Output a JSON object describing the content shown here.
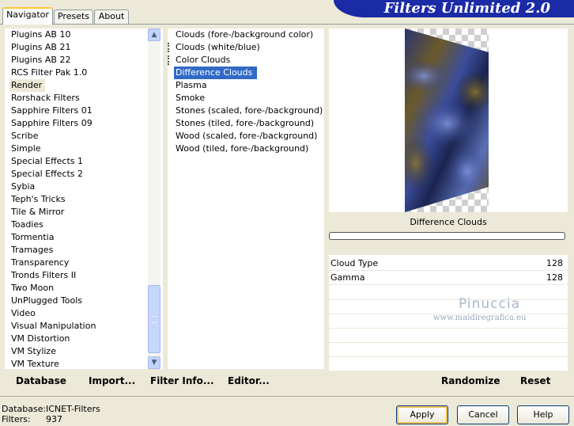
{
  "tabs": [
    {
      "label": "Navigator",
      "active": true
    },
    {
      "label": "Presets",
      "active": false
    },
    {
      "label": "About",
      "active": false
    }
  ],
  "brand": "Filters Unlimited 2.0",
  "categories": [
    "Plugins AB 10",
    "Plugins AB 21",
    "Plugins AB 22",
    "RCS Filter Pak 1.0",
    "Render",
    "Rorshack Filters",
    "Sapphire Filters 01",
    "Sapphire Filters 09",
    "Scribe",
    "Simple",
    "Special Effects 1",
    "Special Effects 2",
    "Sybia",
    "Teph's Tricks",
    "Tile & Mirror",
    "Toadies",
    "Tormentia",
    "Tramages",
    "Transparency",
    "Tronds Filters II",
    "Two Moon",
    "UnPlugged Tools",
    "Video",
    "Visual Manipulation",
    "VM Distortion",
    "VM Stylize",
    "VM Texture"
  ],
  "selected_category": "Render",
  "filters": [
    {
      "label": "Clouds (fore-/background color)",
      "marked": false
    },
    {
      "label": "Clouds (white/blue)",
      "marked": true
    },
    {
      "label": "Color Clouds",
      "marked": true
    },
    {
      "label": "Difference Clouds",
      "marked": false
    },
    {
      "label": "Plasma",
      "marked": false
    },
    {
      "label": "Smoke",
      "marked": false
    },
    {
      "label": "Stones (scaled, fore-/background)",
      "marked": false
    },
    {
      "label": "Stones (tiled, fore-/background)",
      "marked": false
    },
    {
      "label": "Wood (scaled, fore-/background)",
      "marked": false
    },
    {
      "label": "Wood (tiled, fore-/background)",
      "marked": false
    }
  ],
  "selected_filter": "Difference Clouds",
  "preview": {
    "filter_title": "Difference Clouds"
  },
  "params": [
    {
      "label": "Cloud Type",
      "value": "128"
    },
    {
      "label": "Gamma",
      "value": "128"
    }
  ],
  "watermark": {
    "name": "Pinuccia",
    "site": "www.maidiregrafica.eu"
  },
  "toolbar": {
    "database": "Database",
    "import": "Import...",
    "filter_info": "Filter Info...",
    "editor": "Editor...",
    "randomize": "Randomize",
    "reset": "Reset"
  },
  "status": {
    "database_label": "Database:",
    "database_value": "ICNET-Filters",
    "filters_label": "Filters:",
    "filters_value": "937"
  },
  "buttons": {
    "apply": "Apply",
    "cancel": "Cancel",
    "help": "Help"
  }
}
